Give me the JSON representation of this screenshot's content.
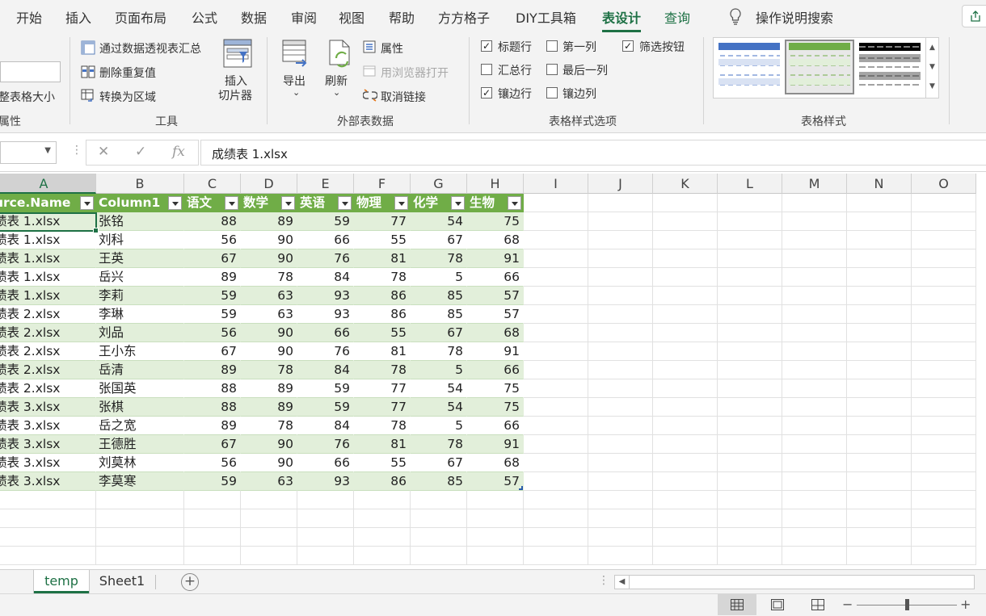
{
  "ribbon_tabs": [
    "开始",
    "插入",
    "页面布局",
    "公式",
    "数据",
    "审阅",
    "视图",
    "帮助",
    "方方格子",
    "DIY工具箱",
    "表设计",
    "查询"
  ],
  "active_tab": "表设计",
  "tell_me": "操作说明搜索",
  "properties_group": {
    "resize_label": "整表格大小",
    "group_label": "属性"
  },
  "tools_group": {
    "pivot_summarize": "通过数据透视表汇总",
    "remove_duplicates": "删除重复值",
    "convert_to_range": "转换为区域",
    "insert_slicer_line1": "插入",
    "insert_slicer_line2": "切片器",
    "group_label": "工具"
  },
  "external_group": {
    "export": "导出",
    "refresh": "刷新",
    "properties": "属性",
    "open_in_browser": "用浏览器打开",
    "unlink": "取消链接",
    "group_label": "外部表数据"
  },
  "style_options": {
    "header_row": {
      "label": "标题行",
      "checked": true
    },
    "total_row": {
      "label": "汇总行",
      "checked": false
    },
    "banded_rows": {
      "label": "镶边行",
      "checked": true
    },
    "first_column": {
      "label": "第一列",
      "checked": false
    },
    "last_column": {
      "label": "最后一列",
      "checked": false
    },
    "banded_columns": {
      "label": "镶边列",
      "checked": false
    },
    "filter_button": {
      "label": "筛选按钮",
      "checked": true
    },
    "group_label": "表格样式选项"
  },
  "table_styles": {
    "group_label": "表格样式",
    "swatch_colors": [
      "#4472c4",
      "#70ad47",
      "#000000"
    ]
  },
  "formula_bar": {
    "content": "成绩表 1.xlsx"
  },
  "columns": [
    "A",
    "B",
    "C",
    "D",
    "E",
    "F",
    "G",
    "H",
    "I",
    "J",
    "K",
    "L",
    "M",
    "N",
    "O"
  ],
  "table": {
    "headers": [
      "urce.Name",
      "Column1",
      "语文",
      "数学",
      "英语",
      "物理",
      "化学",
      "生物"
    ],
    "rows": [
      [
        "绩表 1.xlsx",
        "张铭",
        "88",
        "89",
        "59",
        "77",
        "54",
        "75"
      ],
      [
        "绩表 1.xlsx",
        "刘科",
        "56",
        "90",
        "66",
        "55",
        "67",
        "68"
      ],
      [
        "绩表 1.xlsx",
        "王英",
        "67",
        "90",
        "76",
        "81",
        "78",
        "91"
      ],
      [
        "绩表 1.xlsx",
        "岳兴",
        "89",
        "78",
        "84",
        "78",
        "5",
        "66"
      ],
      [
        "绩表 1.xlsx",
        "李莉",
        "59",
        "63",
        "93",
        "86",
        "85",
        "57"
      ],
      [
        "绩表 2.xlsx",
        "李琳",
        "59",
        "63",
        "93",
        "86",
        "85",
        "57"
      ],
      [
        "绩表 2.xlsx",
        "刘品",
        "56",
        "90",
        "66",
        "55",
        "67",
        "68"
      ],
      [
        "绩表 2.xlsx",
        "王小东",
        "67",
        "90",
        "76",
        "81",
        "78",
        "91"
      ],
      [
        "绩表 2.xlsx",
        "岳清",
        "89",
        "78",
        "84",
        "78",
        "5",
        "66"
      ],
      [
        "绩表 2.xlsx",
        "张国英",
        "88",
        "89",
        "59",
        "77",
        "54",
        "75"
      ],
      [
        "绩表 3.xlsx",
        "张棋",
        "88",
        "89",
        "59",
        "77",
        "54",
        "75"
      ],
      [
        "绩表 3.xlsx",
        "岳之宽",
        "89",
        "78",
        "84",
        "78",
        "5",
        "66"
      ],
      [
        "绩表 3.xlsx",
        "王德胜",
        "67",
        "90",
        "76",
        "81",
        "78",
        "91"
      ],
      [
        "绩表 3.xlsx",
        "刘莫林",
        "56",
        "90",
        "66",
        "55",
        "67",
        "68"
      ],
      [
        "绩表 3.xlsx",
        "李莫寒",
        "59",
        "63",
        "93",
        "86",
        "85",
        "57"
      ]
    ]
  },
  "sheets": [
    {
      "name": "temp",
      "active": true
    },
    {
      "name": "Sheet1",
      "active": false
    }
  ],
  "colors": {
    "accent": "#1e7145",
    "table_header": "#70ad47",
    "table_band": "#e2efda"
  }
}
